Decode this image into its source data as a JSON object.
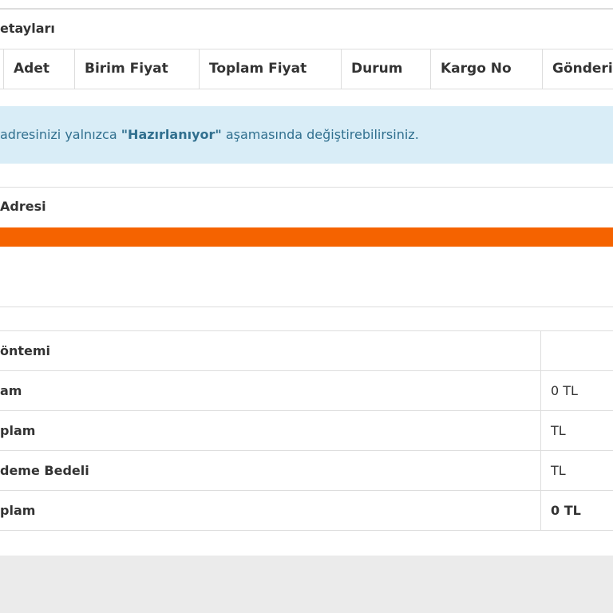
{
  "order_details": {
    "title": "etayları",
    "columns": [
      "Adet",
      "Birim Fiyat",
      "Toplam Fiyat",
      "Durum",
      "Kargo No",
      "Gönderile"
    ]
  },
  "alert": {
    "prefix": "adresinizi yalnızca ",
    "highlight": "\"Hazırlanıyor\"",
    "suffix": " aşamasında değiştirebilirsiniz."
  },
  "address": {
    "title": "Adresi",
    "accent_color": "#f56300"
  },
  "summary": {
    "rows": [
      {
        "label": "öntemi",
        "value": ""
      },
      {
        "label": "am",
        "value": "0 TL"
      },
      {
        "label": "plam",
        "value": "TL"
      },
      {
        "label": "deme Bedeli",
        "value": "TL"
      },
      {
        "label": "plam",
        "value": "0 TL"
      }
    ]
  }
}
